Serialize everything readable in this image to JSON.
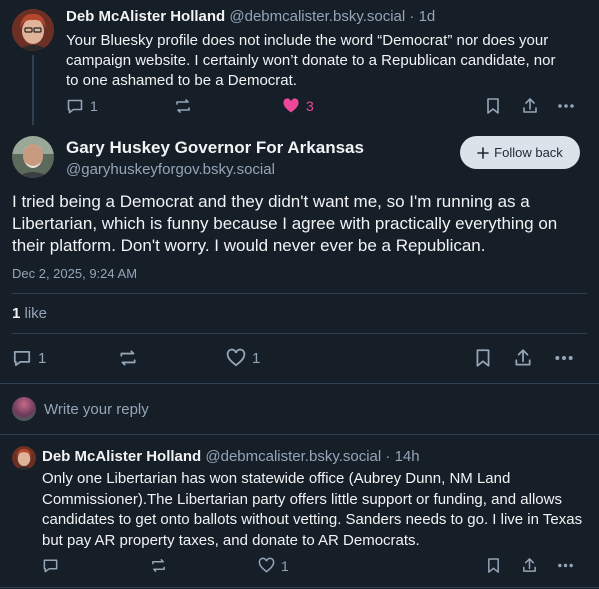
{
  "parent_post": {
    "author_name": "Deb McAlister Holland",
    "author_handle": "@debmcalister.bsky.social",
    "time": "· 1d",
    "text": "Your Bluesky profile does not include the word “Democrat” nor does your campaign website. I certainly won’t donate to a Republican candidate, nor to one ashamed to be a Democrat.",
    "reply_count": "1",
    "like_count": "3"
  },
  "main_post": {
    "author_name": "Gary Huskey Governor For Arkansas",
    "author_handle": "@garyhuskeyforgov.bsky.social",
    "follow_label": "Follow back",
    "text": "I tried being a Democrat and they didn't want me, so I'm running as a Libertarian, which is funny because I agree with practically everything on their platform. Don't worry. I would never ever be a Republican.",
    "timestamp": "Dec 2, 2025, 9:24 AM",
    "like_stat_count": "1",
    "like_stat_label": "like",
    "reply_count": "1",
    "like_count": "1"
  },
  "reply_composer": {
    "placeholder": "Write your reply"
  },
  "reply_post": {
    "author_name": "Deb McAlister Holland",
    "author_handle": "@debmcalister.bsky.social",
    "time": "· 14h",
    "text": "Only one Libertarian has won statewide office (Aubrey Dunn, NM Land Commissioner).The Libertarian party offers little support or funding, and allows candidates to get onto ballots without vetting. Sanders needs to go. I live in Texas but pay AR property taxes, and donate to AR Democrats.",
    "like_count": "1"
  },
  "colors": {
    "background": "#161e27",
    "text": "#f1f3f5",
    "muted": "#93a5b7",
    "like_active": "#ec4899",
    "divider": "#2e4052"
  }
}
